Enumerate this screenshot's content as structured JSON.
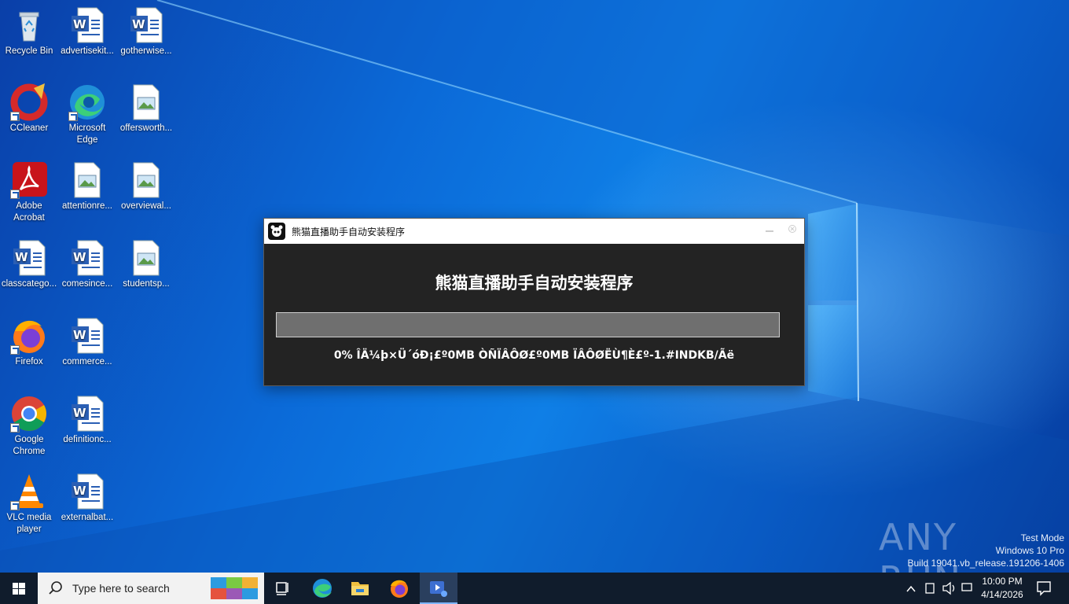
{
  "desktop": {
    "icons": [
      {
        "label": "Recycle Bin"
      },
      {
        "label": "advertisekit..."
      },
      {
        "label": "gotherwise..."
      },
      {
        "label": "CCleaner"
      },
      {
        "label": "Microsoft Edge"
      },
      {
        "label": "offersworth..."
      },
      {
        "label": "Adobe Acrobat"
      },
      {
        "label": "attentionre..."
      },
      {
        "label": "overviewal..."
      },
      {
        "label": "classcatego..."
      },
      {
        "label": "comesince..."
      },
      {
        "label": "studentsp..."
      },
      {
        "label": "Firefox"
      },
      {
        "label": "commerce..."
      },
      {
        "label": "Google Chrome"
      },
      {
        "label": "definitionc..."
      },
      {
        "label": "VLC media player"
      },
      {
        "label": "externalbat..."
      }
    ]
  },
  "installer": {
    "window_title": "熊猫直播助手自动安装程序",
    "heading": "熊猫直播助手自动安装程序",
    "progress_percent": 0,
    "status_text": "0% ÎÄ¼þ×Ü´óÐ¡£º0MB ÒÑÏÂÔØ£º0MB ÏÂÔØËÙ¶È£º-1.#INDKB/Ãë",
    "accent": "#3b7ddd"
  },
  "watermark": {
    "brand": "ANY RUN",
    "line1": "Test Mode",
    "line2": "Windows 10 Pro",
    "line3": "Build 19041.vb_release.191206-1406"
  },
  "taskbar": {
    "search_placeholder": "Type here to search",
    "time": "10:00 PM",
    "date": "4/14/2026"
  }
}
